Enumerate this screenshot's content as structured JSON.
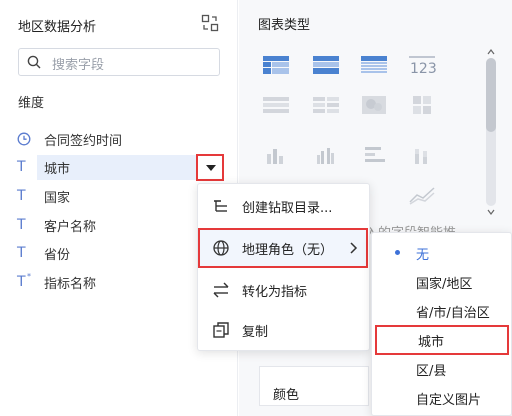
{
  "left_panel": {
    "title": "地区数据分析",
    "search_placeholder": "搜索字段",
    "section_label": "维度",
    "fields": [
      {
        "icon": "clock-icon",
        "type_glyph": "",
        "label": "合同签约时间"
      },
      {
        "icon": "text-type-icon",
        "type_glyph": "T",
        "label": "城市"
      },
      {
        "icon": "text-type-icon",
        "type_glyph": "T",
        "label": "国家"
      },
      {
        "icon": "text-type-icon",
        "type_glyph": "T",
        "label": "客户名称"
      },
      {
        "icon": "text-type-icon",
        "type_glyph": "T",
        "label": "省份"
      },
      {
        "icon": "text-type-indicator-icon",
        "type_glyph": "T",
        "label": "指标名称"
      }
    ]
  },
  "right_panel": {
    "title": "图表类型",
    "partial_text": "入的字段智能推",
    "partial_label": "颜色",
    "partial_row": "☰ ——"
  },
  "context_menu": {
    "items": [
      {
        "icon": "drill-directory-icon",
        "label": "创建钻取目录..."
      },
      {
        "icon": "globe-icon",
        "label": "地理角色（无）",
        "has_submenu": true
      },
      {
        "icon": "convert-icon",
        "label": "转化为指标"
      },
      {
        "icon": "copy-icon",
        "label": "复制"
      }
    ]
  },
  "submenu": {
    "items": [
      {
        "label": "无",
        "selected": true
      },
      {
        "label": "国家/地区",
        "selected": false
      },
      {
        "label": "省/市/自治区",
        "selected": false
      },
      {
        "label": "城市",
        "selected": false,
        "highlighted": true
      },
      {
        "label": "区/县",
        "selected": false
      },
      {
        "label": "自定义图片",
        "selected": false
      }
    ]
  },
  "colors": {
    "accent": "#3d71d8",
    "highlight_border": "#e5393a",
    "field_icon": "#5b7ccf"
  }
}
